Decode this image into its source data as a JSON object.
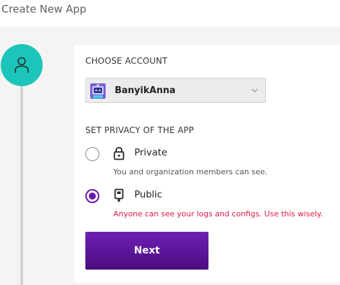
{
  "page": {
    "title": "Create New App"
  },
  "account": {
    "section_label": "CHOOSE ACCOUNT",
    "selected": "BanyikAnna",
    "avatar_icon": "robot-avatar-icon"
  },
  "privacy": {
    "section_label": "SET PRIVACY OF THE APP",
    "options": [
      {
        "label": "Private",
        "description": "You and organization members can see.",
        "icon": "lock-icon",
        "selected": false
      },
      {
        "label": "Public",
        "description": "Anyone can see your logs and configs. Use this wisely.",
        "icon": "public-log-icon",
        "selected": true
      }
    ]
  },
  "actions": {
    "next_label": "Next"
  },
  "colors": {
    "accent": "#6a17a8",
    "step_circle": "#1bc5b9",
    "warning": "#e0184a"
  }
}
